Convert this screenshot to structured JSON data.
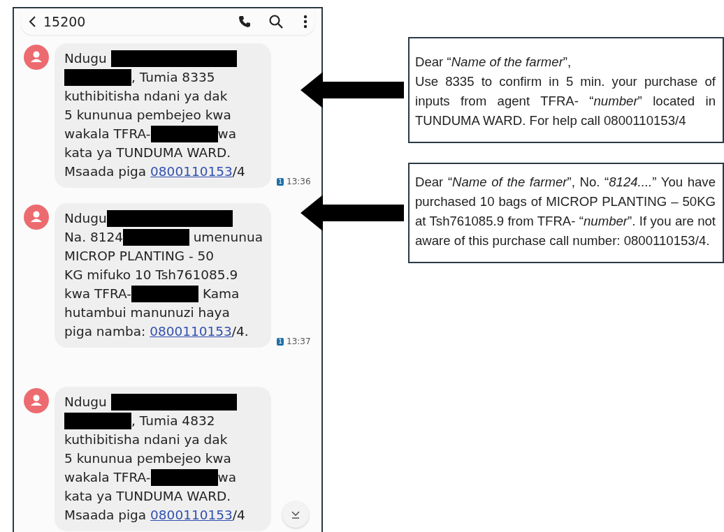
{
  "header": {
    "title": "15200"
  },
  "messages": [
    {
      "time": "13:36",
      "sim": "1",
      "lines": [
        [
          {
            "kind": "text",
            "text": "Ndugu "
          },
          {
            "kind": "redaction"
          }
        ],
        [
          {
            "kind": "redaction"
          },
          {
            "kind": "text",
            "text": ", Tumia 8335"
          }
        ],
        [
          {
            "kind": "text",
            "text": "kuthibitisha ndani ya dak"
          }
        ],
        [
          {
            "kind": "text",
            "text": "5 kununua pembejeo kwa"
          }
        ],
        [
          {
            "kind": "text",
            "text": "wakala TFRA-"
          },
          {
            "kind": "redaction"
          },
          {
            "kind": "text",
            "text": "wa"
          }
        ],
        [
          {
            "kind": "text",
            "text": "kata ya TUNDUMA WARD."
          }
        ],
        [
          {
            "kind": "text",
            "text": "Msaada piga "
          },
          {
            "kind": "link",
            "text": "0800110153"
          },
          {
            "kind": "text",
            "text": "/4"
          }
        ]
      ]
    },
    {
      "time": "13:37",
      "sim": "1",
      "lines": [
        [
          {
            "kind": "text",
            "text": "Ndugu"
          },
          {
            "kind": "redaction"
          }
        ],
        [
          {
            "kind": "text",
            "text": "Na. 8124"
          },
          {
            "kind": "redaction"
          },
          {
            "kind": "text",
            "text": " umenunua"
          }
        ],
        [
          {
            "kind": "text",
            "text": "MICROP PLANTING - 50"
          }
        ],
        [
          {
            "kind": "text",
            "text": "KG mifuko 10 Tsh761085.9"
          }
        ],
        [
          {
            "kind": "text",
            "text": "kwa TFRA-"
          },
          {
            "kind": "redaction"
          },
          {
            "kind": "text",
            "text": " Kama"
          }
        ],
        [
          {
            "kind": "text",
            "text": "hutambui manunuzi haya"
          }
        ],
        [
          {
            "kind": "text",
            "text": "piga namba: "
          },
          {
            "kind": "link",
            "text": "0800110153"
          },
          {
            "kind": "text",
            "text": "/4."
          }
        ]
      ]
    },
    {
      "lines": [
        [
          {
            "kind": "text",
            "text": "Ndugu "
          },
          {
            "kind": "redaction"
          }
        ],
        [
          {
            "kind": "redaction"
          },
          {
            "kind": "text",
            "text": ", Tumia 4832"
          }
        ],
        [
          {
            "kind": "text",
            "text": "kuthibitisha ndani ya dak"
          }
        ],
        [
          {
            "kind": "text",
            "text": "5 kununua pembejeo kwa"
          }
        ],
        [
          {
            "kind": "text",
            "text": "wakala TFRA-"
          },
          {
            "kind": "redaction"
          },
          {
            "kind": "text",
            "text": "wa"
          }
        ],
        [
          {
            "kind": "text",
            "text": "kata ya TUNDUMA WARD."
          }
        ],
        [
          {
            "kind": "text",
            "text": "Msaada piga "
          },
          {
            "kind": "link",
            "text": "0800110153"
          },
          {
            "kind": "text",
            "text": "/4"
          }
        ]
      ]
    }
  ],
  "translations": [
    {
      "paragraphs": [
        "Dear “*Name of the farmer*”,",
        "Use 8335 to confirm in 5 min. your purchase of inputs from agent  TFRA- “*number*” located in TUNDUMA WARD. For help call 0800110153/4"
      ]
    },
    {
      "paragraphs": [
        "Dear “*Name of the farmer*”, No. “*8124....*” You have purchased 10 bags of MICROP PLANTING – 50KG  at Tsh761085.9 from TFRA- “*number*”. If you are not aware of this purchase call number: 0800110153/4."
      ]
    }
  ]
}
